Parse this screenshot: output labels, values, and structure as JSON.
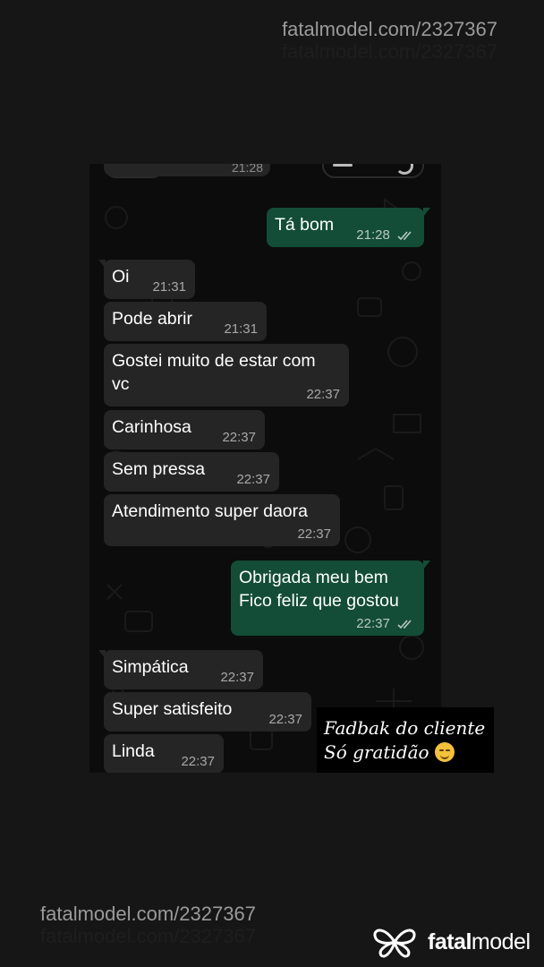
{
  "watermark": {
    "top_url": "fatalmodel.com/2327367",
    "top_url_shadow": "fatalmodel.com/2327367",
    "bottom_url": "fatalmodel.com/2327367",
    "bottom_url_shadow": "fatalmodel.com/2327367"
  },
  "chat": {
    "previous_time": "21:28",
    "messages": [
      {
        "text": "Tá bom",
        "time": "21:28",
        "direction": "out"
      },
      {
        "text": "Oi",
        "time": "21:31",
        "direction": "in"
      },
      {
        "text": "Pode abrir",
        "time": "21:31",
        "direction": "in"
      },
      {
        "text": "Gostei muito de estar com vc",
        "line1": "Gostei muito de estar com",
        "line2": "vc",
        "time": "22:37",
        "direction": "in"
      },
      {
        "text": "Carinhosa",
        "time": "22:37",
        "direction": "in"
      },
      {
        "text": "Sem pressa",
        "time": "22:37",
        "direction": "in"
      },
      {
        "text": "Atendimento super daora",
        "time": "22:37",
        "direction": "in"
      },
      {
        "text": "Obrigada meu bem Fico feliz que gostou",
        "line1": "Obrigada meu bem",
        "line2": "Fico feliz que gostou",
        "time": "22:37",
        "direction": "out"
      },
      {
        "text": "Simpática",
        "time": "22:37",
        "direction": "in"
      },
      {
        "text": "Super satisfeito",
        "time": "22:37",
        "direction": "in"
      },
      {
        "text": "Linda",
        "time": "22:37",
        "direction": "in"
      }
    ]
  },
  "caption": {
    "line1": "Fadbak do cliente",
    "line2": "Só gratidão",
    "emoji": "smiling-face-icon"
  },
  "logo": {
    "part1": "fatal",
    "part2": "model",
    "icon": "fatalmodel-logo-icon"
  },
  "colors": {
    "page_background": "#161616",
    "incoming_bubble": "#252525",
    "outgoing_bubble": "#134d37",
    "read_ticks": "#b8c9c0"
  }
}
